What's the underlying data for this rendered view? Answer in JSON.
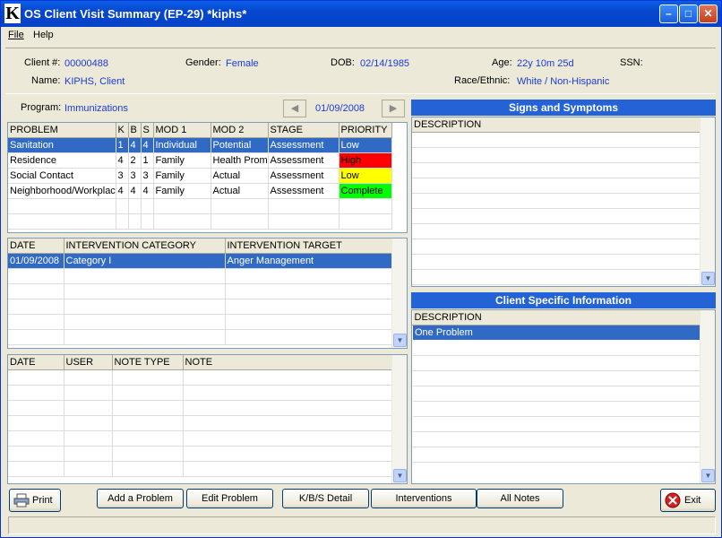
{
  "window": {
    "logo": "K",
    "title": "OS Client Visit Summary (EP-29)  *kiphs*",
    "min_glyph": "–",
    "max_glyph": "□",
    "close_glyph": "✕"
  },
  "menu": {
    "file": "File",
    "help": "Help"
  },
  "client": {
    "client_no_label": "Client #:",
    "client_no": "00000488",
    "gender_label": "Gender:",
    "gender": "Female",
    "dob_label": "DOB:",
    "dob": "02/14/1985",
    "age_label": "Age:",
    "age": "22y 10m 25d",
    "ssn_label": "SSN:",
    "ssn": "",
    "name_label": "Name:",
    "name": "KIPHS, Client",
    "race_label": "Race/Ethnic:",
    "race": "White  /  Non-Hispanic"
  },
  "program": {
    "label": "Program:",
    "value": "Immunizations",
    "date": "01/09/2008",
    "prev_glyph": "◀",
    "next_glyph": "▶"
  },
  "problems": {
    "columns": [
      "PROBLEM",
      "K",
      "B",
      "S",
      "MOD 1",
      "MOD 2",
      "STAGE",
      "PRIORITY"
    ],
    "rows": [
      {
        "problem": "Sanitation",
        "k": "1",
        "b": "4",
        "s": "4",
        "mod1": "Individual",
        "mod2": "Potential",
        "stage": "Assessment",
        "priority": "Low",
        "priority_color": "",
        "selected": true
      },
      {
        "problem": "Residence",
        "k": "4",
        "b": "2",
        "s": "1",
        "mod1": "Family",
        "mod2": "Health Promotion",
        "stage": "Assessment",
        "priority": "High",
        "priority_color": "#ff0000",
        "selected": false
      },
      {
        "problem": "Social Contact",
        "k": "3",
        "b": "3",
        "s": "3",
        "mod1": "Family",
        "mod2": "Actual",
        "stage": "Assessment",
        "priority": "Low",
        "priority_color": "#ffff00",
        "selected": false
      },
      {
        "problem": "Neighborhood/Workplace",
        "k": "4",
        "b": "4",
        "s": "4",
        "mod1": "Family",
        "mod2": "Actual",
        "stage": "Assessment",
        "priority": "Complete",
        "priority_color": "#00ff00",
        "selected": false
      }
    ]
  },
  "interventions": {
    "columns": [
      "DATE",
      "INTERVENTION CATEGORY",
      "INTERVENTION TARGET"
    ],
    "rows": [
      {
        "date": "01/09/2008",
        "category": "Category I",
        "target": "Anger Management",
        "selected": true
      }
    ]
  },
  "notes": {
    "columns": [
      "DATE",
      "USER",
      "NOTE TYPE",
      "NOTE"
    ]
  },
  "signs": {
    "title": "Signs and Symptoms",
    "column": "DESCRIPTION"
  },
  "client_info": {
    "title": "Client Specific Information",
    "column": "DESCRIPTION",
    "rows": [
      "One Problem"
    ]
  },
  "buttons": {
    "print": "Print",
    "add_problem": "Add a Problem",
    "edit_problem": "Edit Problem",
    "kbs_detail": "K/B/S Detail",
    "interventions": "Interventions",
    "all_notes": "All Notes",
    "exit": "Exit"
  },
  "colors": {
    "selection": "#316ac5",
    "accent_blue": "#1b3cd0",
    "high": "#ff0000",
    "low": "#ffff00",
    "complete": "#00ff00"
  }
}
